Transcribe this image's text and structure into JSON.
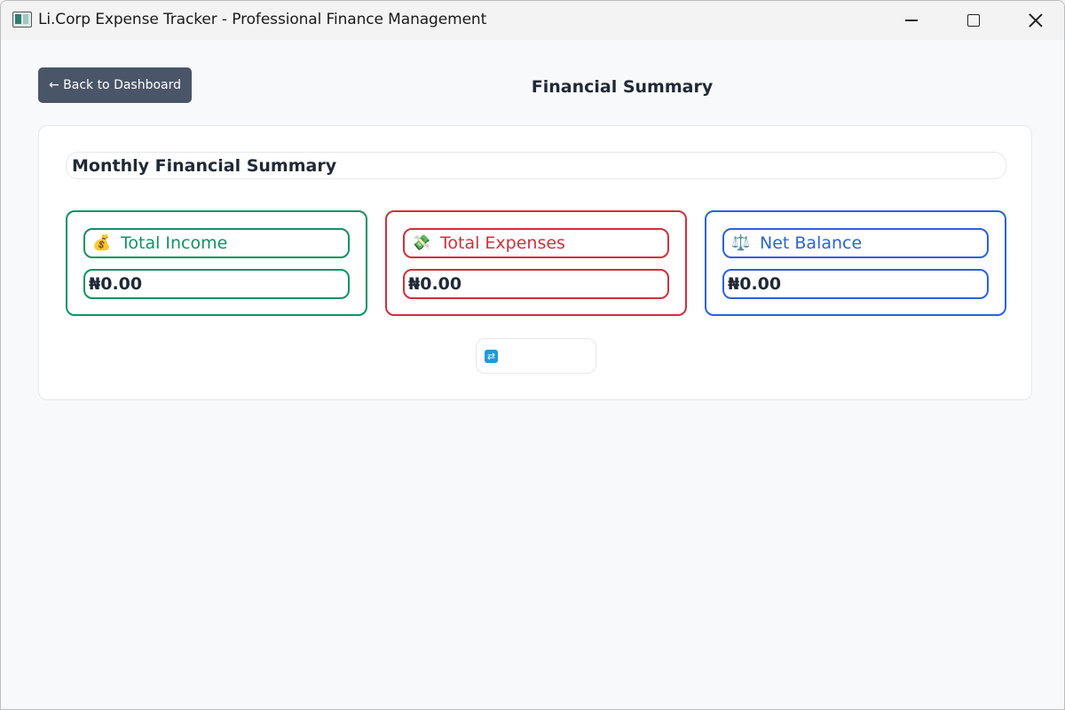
{
  "window": {
    "title": "Li.Corp Expense Tracker - Professional Finance Management"
  },
  "header": {
    "back_label": "← Back to Dashboard",
    "page_title": "Financial Summary"
  },
  "summary": {
    "section_title": "Monthly Financial Summary",
    "cards": [
      {
        "icon": "money-bag-icon",
        "emoji": "💰",
        "label": "Total Income",
        "value": "₦0.00",
        "color": "#0e9363"
      },
      {
        "icon": "money-with-wings-icon",
        "emoji": "💸",
        "label": "Total Expenses",
        "value": "₦0.00",
        "color": "#d0303a"
      },
      {
        "icon": "balance-scale-icon",
        "emoji": "⚖️",
        "label": "Net Balance",
        "value": "₦0.00",
        "color": "#2a63d9"
      }
    ],
    "refresh_icon": "refresh-icon",
    "refresh_glyph": "⇄"
  }
}
